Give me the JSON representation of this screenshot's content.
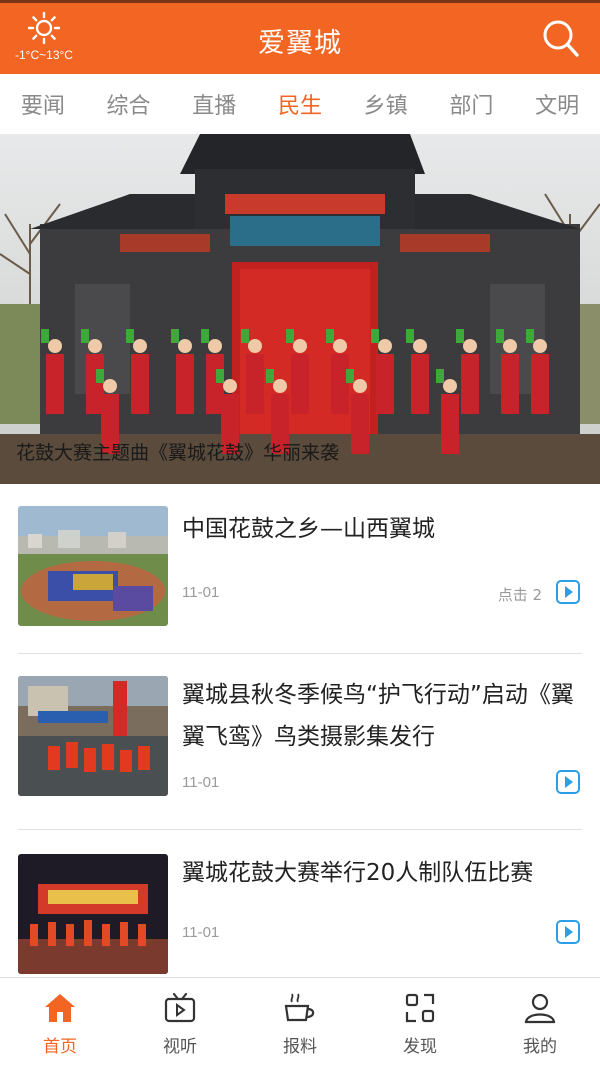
{
  "header": {
    "title": "爱翼城",
    "weather_temp": "-1°C~13°C",
    "weather_icon": "sun-icon",
    "search_icon": "search-icon",
    "bg_color": "#f26522"
  },
  "tabs": [
    {
      "label": "要闻",
      "active": false
    },
    {
      "label": "综合",
      "active": false
    },
    {
      "label": "直播",
      "active": false
    },
    {
      "label": "民生",
      "active": true
    },
    {
      "label": "乡镇",
      "active": false
    },
    {
      "label": "部门",
      "active": false
    },
    {
      "label": "文明",
      "active": false
    }
  ],
  "banner": {
    "caption": "花鼓大赛主题曲《翼城花鼓》华丽来袭"
  },
  "news": [
    {
      "title": "中国花鼓之乡—山西翼城",
      "date": "11-01",
      "clicks": "点击 2"
    },
    {
      "title": "翼城县秋冬季候鸟“护飞行动”启动《翼翼飞鸾》鸟类摄影集发行",
      "date": "11-01",
      "clicks": ""
    },
    {
      "title": "翼城花鼓大赛举行20人制队伍比赛",
      "date": "11-01",
      "clicks": ""
    }
  ],
  "bottom_nav": [
    {
      "label": "首页",
      "icon": "home-icon",
      "active": true
    },
    {
      "label": "视听",
      "icon": "tv-icon",
      "active": false
    },
    {
      "label": "报料",
      "icon": "cup-icon",
      "active": false
    },
    {
      "label": "发现",
      "icon": "discover-icon",
      "active": false
    },
    {
      "label": "我的",
      "icon": "user-icon",
      "active": false
    }
  ],
  "colors": {
    "accent": "#f26522",
    "play_button": "#2a9fe6"
  }
}
